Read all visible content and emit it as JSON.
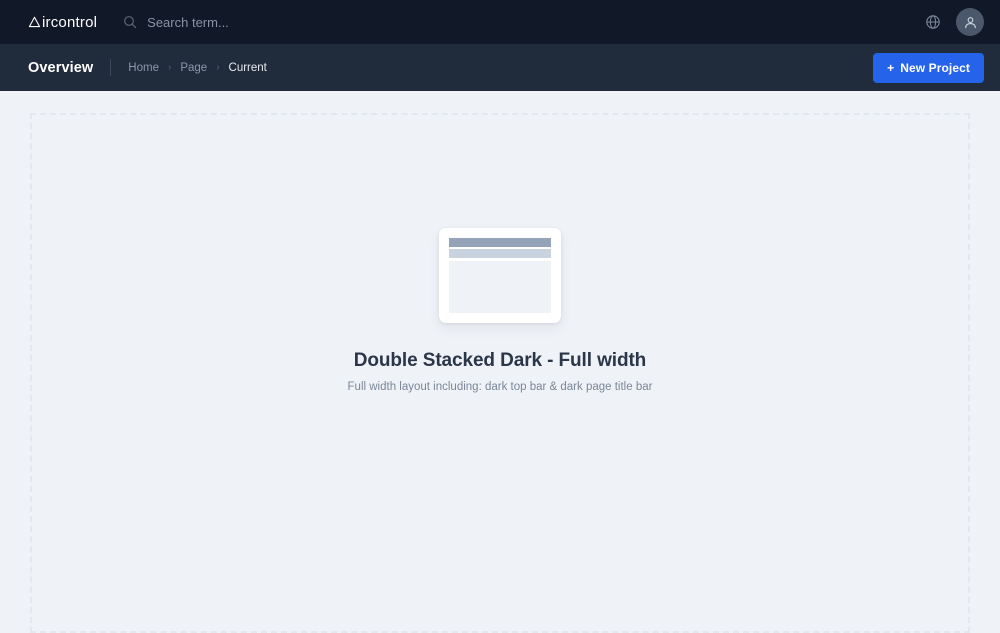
{
  "topbar": {
    "brand": {
      "mark_icon": "triangle-logo-icon",
      "text": "ircontrol",
      "full_name": "Aircontrol"
    },
    "search": {
      "icon": "search-icon",
      "placeholder": "Search term...",
      "value": ""
    },
    "actions": {
      "language_icon": "globe-icon",
      "avatar_icon": "user-icon"
    },
    "background_color": "#111827"
  },
  "titlebar": {
    "page_title": "Overview",
    "breadcrumb": {
      "items": [
        {
          "label": "Home",
          "current": false
        },
        {
          "label": "Page",
          "current": false
        },
        {
          "label": "Current",
          "current": true
        }
      ],
      "separator": "›"
    },
    "new_project": {
      "plus": "+",
      "label": "New Project",
      "color": "#2563eb"
    },
    "background_color": "#202b3b"
  },
  "main": {
    "background_color": "#eff2f7",
    "dashed_border_color": "#e3e7ee",
    "empty_state": {
      "illustration": {
        "name": "layout-wireframe-icon",
        "card_color": "#ffffff",
        "top_bar_color": "#94a3b8",
        "title_bar_color": "#c9d3e0",
        "body_color": "#eff2f7"
      },
      "title": "Double Stacked Dark - Full width",
      "subtitle": "Full width layout including: dark top bar & dark page title bar"
    }
  }
}
